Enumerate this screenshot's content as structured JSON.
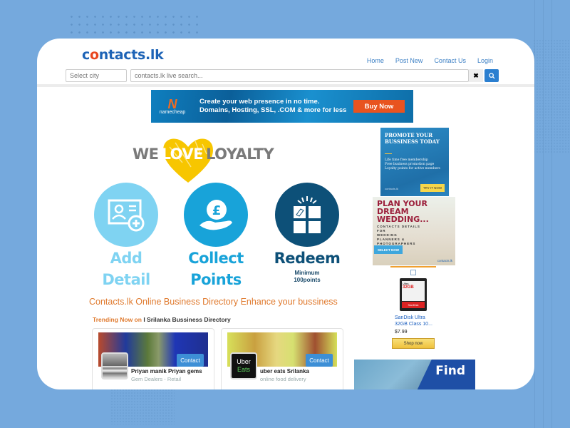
{
  "header": {
    "logo_prefix": "c",
    "logo_o": "o",
    "logo_suffix": "ntacts.lk",
    "nav": [
      "Home",
      "Post New",
      "Contact Us",
      "Login"
    ],
    "city_placeholder": "Select city",
    "search_placeholder": "contacts.lk live search...",
    "clear_icon": "✖",
    "search_icon": "⚲"
  },
  "banner": {
    "brand": "namecheap",
    "brand_mark": "N",
    "line1": "Create your web presence in no time.",
    "line2": "Domains, Hosting, SSL, .COM & more for less",
    "cta": "Buy Now"
  },
  "loyalty": {
    "we": "WE",
    "love": "LOVE",
    "loyalty": "LOYALTY",
    "colors": {
      "heart": "#f7c600",
      "text": "#7a7a7a"
    }
  },
  "steps": [
    {
      "line1": "Add",
      "line2": "Detail",
      "icon": "add-contact-card",
      "color": "#7fd3f2",
      "text_color": "#7fd3f2"
    },
    {
      "line1": "Collect",
      "line2": "Points",
      "icon": "hand-pound-coin",
      "color": "#18a3d9",
      "text_color": "#18a3d9"
    },
    {
      "line1": "Redeem",
      "sub1": "Minimum",
      "sub2": "100points",
      "icon": "gift-box",
      "color": "#0d5078",
      "text_color": "#0d5078"
    }
  ],
  "tagline": "Contacts.lk Online Business Directory Enhance your bussiness",
  "trending": {
    "highlight": "Trending Now on",
    "rest": " I Srilanka Bussiness Directory"
  },
  "cards": [
    {
      "name": "Priyan manik Priyan gems",
      "category": "Gem Dealers - Retail",
      "button": "Contact"
    },
    {
      "name": "uber eats Srilanka",
      "category": "online food delivery",
      "button": "Contact",
      "avatar_line1": "Uber",
      "avatar_line2": "Eats"
    }
  ],
  "side_ads": {
    "promote": {
      "title1": "PROMOTE YOUR",
      "title2": "BUSSINESS TODAY",
      "items": [
        "Life time free membership",
        "Free business promotion page",
        "Loyalty points for active members"
      ],
      "cta": "TRY IT NOW",
      "logo": "contacts.lk"
    },
    "wedding": {
      "title": [
        "PLAN YOUR",
        "DREAM",
        "WEDDING..."
      ],
      "sub": [
        "CONTACTS DETAILS",
        "FOR",
        "WEDDING",
        "PLANNERS &",
        "PHOTOGRAPHERS"
      ],
      "cta": "SELECT NOW",
      "logo": "contacts.lk"
    },
    "product": {
      "title": "SanDisk Ultra 32GB Class 10...",
      "price": "$7.99",
      "cta": "Shop now",
      "card_brand": "Ultra",
      "card_size": "32GB",
      "card_maker": "SanDisk"
    },
    "find": {
      "text": "Find"
    }
  }
}
